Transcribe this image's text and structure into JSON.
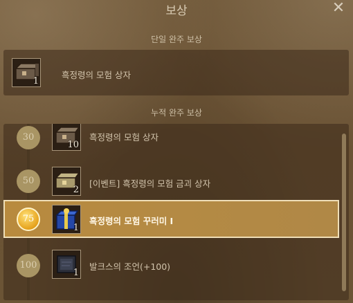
{
  "window": {
    "title": "보상",
    "close_glyph": "✕"
  },
  "single": {
    "label": "단일 완주 보상",
    "item": {
      "name": "흑정령의 모험 상자",
      "qty": "1",
      "icon": "chest-icon"
    }
  },
  "cumulative": {
    "label": "누적 완주 보상",
    "rows": [
      {
        "milestone": "30",
        "name": "흑정령의 모험 상자",
        "qty": "10",
        "icon": "chest-icon",
        "selected": false
      },
      {
        "milestone": "50",
        "name": "[이벤트] 흑정령의 모험 금괴 상자",
        "qty": "2",
        "icon": "gold-chest-icon",
        "selected": false
      },
      {
        "milestone": "75",
        "name": "흑정령의 모험 꾸러미 I",
        "qty": "1",
        "icon": "blue-gift-box-icon",
        "selected": true
      },
      {
        "milestone": "100",
        "name": "발크스의 조언(+100)",
        "qty": "1",
        "icon": "scroll-icon",
        "selected": false
      }
    ]
  },
  "colors": {
    "accent": "#b88a3e",
    "selected_border": "#f0dfb8"
  }
}
